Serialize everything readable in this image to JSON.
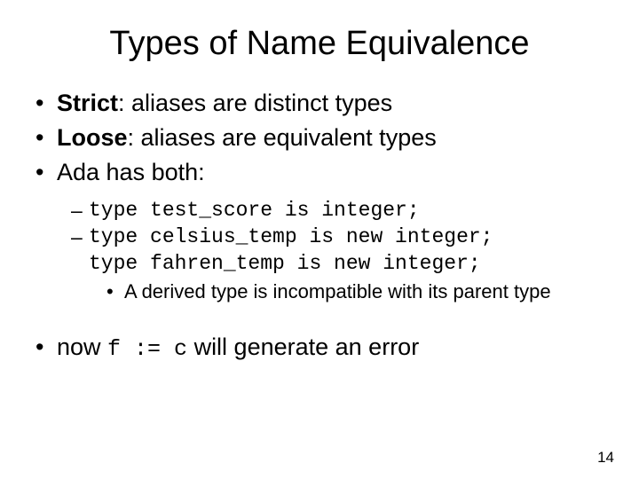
{
  "title": "Types of Name Equivalence",
  "bullet1_bold": "Strict",
  "bullet1_rest": ": aliases are distinct types",
  "bullet2_bold": "Loose",
  "bullet2_rest": ": aliases are equivalent types",
  "bullet3": "Ada has both:",
  "code1": "type test_score is integer;",
  "code2": "type celsius_temp is new integer;",
  "code3": "type fahren_temp is new integer;",
  "subnote": "A derived type is incompatible with its parent type",
  "last_pre": "now ",
  "last_code": "f := c",
  "last_post": " will generate an error",
  "page_number": "14"
}
